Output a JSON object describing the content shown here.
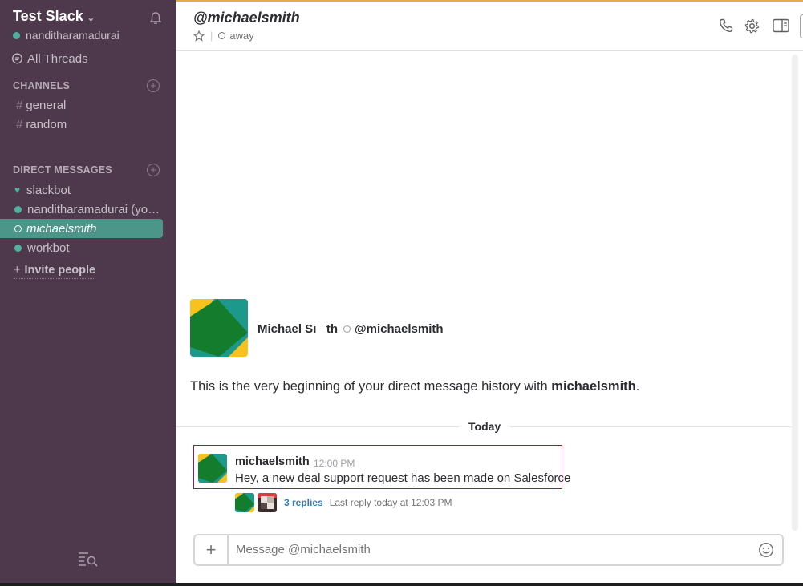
{
  "sidebar": {
    "team_name": "Test Slack",
    "current_user": "nanditharamadurai",
    "all_threads": "All Threads",
    "channels_header": "CHANNELS",
    "channels": [
      {
        "label": "general"
      },
      {
        "label": "random"
      }
    ],
    "dms_header": "DIRECT MESSAGES",
    "dms": [
      {
        "label": "slackbot",
        "status": "heart"
      },
      {
        "label": "nanditharamadurai (yo…",
        "status": "online"
      },
      {
        "label": "michaelsmith",
        "status": "away",
        "active": true
      },
      {
        "label": "workbot",
        "status": "online"
      }
    ],
    "invite": "Invite people"
  },
  "header": {
    "title": "@michaelsmith",
    "presence": "away",
    "icons": [
      "star-icon",
      "phone-icon",
      "gear-icon",
      "sidebar-toggle-icon"
    ]
  },
  "intro": {
    "name": "Michael Sı   th",
    "handle": "@michaelsmith",
    "text_prefix": "This is the very beginning of your direct message history with",
    "text_user": "michaelsmith",
    "text_suffix": "."
  },
  "day_divider": "Today",
  "messages": [
    {
      "author": "michaelsmith",
      "time": "12:00 PM",
      "text": "Hey, a new deal support request has been made on Salesforce",
      "replies": "3 replies",
      "last_reply": "Last reply today at 12:03 PM"
    }
  ],
  "composer": {
    "placeholder": "Message @michaelsmith"
  },
  "colors": {
    "sidebar_bg": "#4d394b",
    "active_item": "#4c9689",
    "presence_green": "#4fb0a0",
    "link_blue": "#2a80b9",
    "highlight_border": "#a0106e"
  }
}
